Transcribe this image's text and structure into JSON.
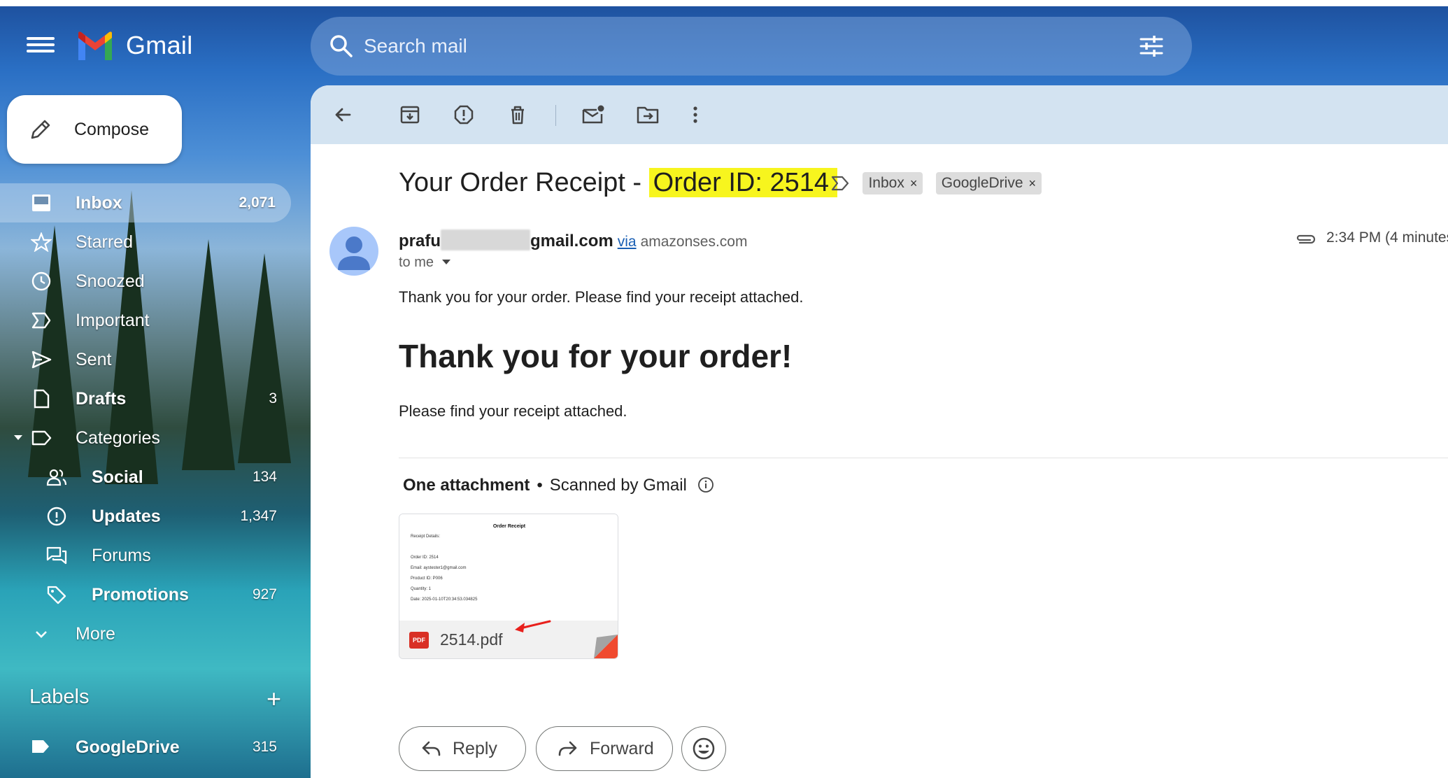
{
  "app": {
    "name": "Gmail"
  },
  "search": {
    "placeholder": "Search mail"
  },
  "sidebar": {
    "compose_label": "Compose",
    "items": [
      {
        "label": "Inbox",
        "count": "2,071"
      },
      {
        "label": "Starred",
        "count": ""
      },
      {
        "label": "Snoozed",
        "count": ""
      },
      {
        "label": "Important",
        "count": ""
      },
      {
        "label": "Sent",
        "count": ""
      },
      {
        "label": "Drafts",
        "count": "3"
      },
      {
        "label": "Categories",
        "count": ""
      },
      {
        "label": "Social",
        "count": "134"
      },
      {
        "label": "Updates",
        "count": "1,347"
      },
      {
        "label": "Forums",
        "count": ""
      },
      {
        "label": "Promotions",
        "count": "927"
      },
      {
        "label": "More",
        "count": ""
      }
    ],
    "labels_heading": "Labels",
    "labels_add": "+",
    "labels": [
      {
        "label": "GoogleDrive",
        "count": "315"
      }
    ]
  },
  "toolbar": {
    "icons": [
      "back-arrow-icon",
      "archive-icon",
      "report-spam-icon",
      "delete-icon",
      "mark-unread-icon",
      "move-to-icon",
      "more-vert-icon"
    ]
  },
  "email": {
    "subject_prefix": "Your Order Receipt - ",
    "subject_highlight": "Order ID: 2514",
    "chips": [
      {
        "label": "Inbox",
        "close": "×"
      },
      {
        "label": "GoogleDrive",
        "close": "×"
      }
    ],
    "sender_start": "prafu",
    "sender_end": "gmail.com",
    "via_label": "via",
    "via_domain": "amazonses.com",
    "to_label": "to me",
    "time": "2:34 PM (4 minutes",
    "intro": "Thank you for your order. Please find your receipt attached.",
    "heading": "Thank you for your order!",
    "body": "Please find your receipt attached.",
    "attachment_heading": "One attachment",
    "separator": "•",
    "scanned_label": "Scanned by Gmail",
    "attachment": {
      "file_name": "2514.pdf",
      "badge": "PDF",
      "preview": {
        "title": "Order Receipt",
        "lines": [
          "Receipt Details:",
          "",
          "Order ID: 2514",
          "Email: aystester1@gmail.com",
          "Product ID: P006",
          "Quantity: 1",
          "Date: 2025-01-10T20:34:53.034825"
        ]
      }
    }
  },
  "actions": {
    "reply": "Reply",
    "forward": "Forward"
  },
  "colors": {
    "highlight": "#f7f51e",
    "toolbar_bg": "#d3e3f1",
    "link": "#1a5fb4",
    "pdf_red": "#d93025"
  }
}
